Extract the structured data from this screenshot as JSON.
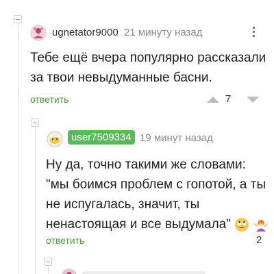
{
  "comments": [
    {
      "username": "ugnetator9000",
      "time": "21 минуту назад",
      "text_lines": [
        "Тебе ещё вчера популярно рассказали",
        "за твои невыдуманные басни."
      ],
      "reply_label": "ответить",
      "rating": "7"
    },
    {
      "username": "user7509334",
      "time": "19 минут назад",
      "text_lines": [
        "Ну да, точно такими же словами:",
        "\"мы боимся проблем с гопотой, а ты",
        "не испугалась, значит, ты",
        "ненастоящая и все выдумала\""
      ],
      "reply_label": "ответить",
      "rating": "2"
    }
  ],
  "colors": {
    "reply_link": "#4d9e3f",
    "username_badge": "#5cb85c",
    "time": "#8a8a8a"
  },
  "icons": [
    "collapse-icon",
    "kebab-menu-icon",
    "upvote-icon",
    "downvote-icon",
    "rolling-eyes-emoji",
    "shrugging-woman-emoji"
  ]
}
